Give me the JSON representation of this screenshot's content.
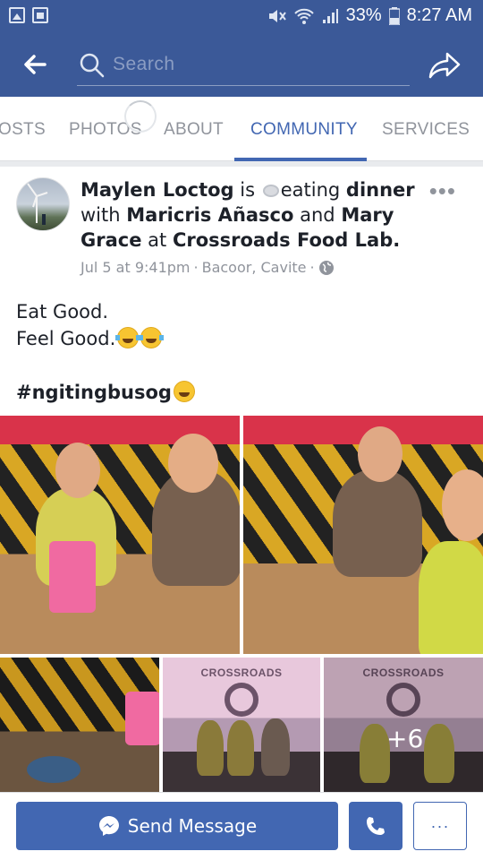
{
  "status_bar": {
    "battery": "33%",
    "time": "8:27 AM",
    "icons": [
      "gallery-icon",
      "bag-icon",
      "mute-icon",
      "wifi-icon",
      "signal-icon",
      "battery-icon"
    ]
  },
  "app_bar": {
    "search_placeholder": "Search",
    "colors": {
      "bar": "#3b5998",
      "accent": "#4267b2"
    }
  },
  "tabs": [
    {
      "label": "OSTS",
      "active": false
    },
    {
      "label": "PHOTOS",
      "active": false
    },
    {
      "label": "ABOUT",
      "active": false
    },
    {
      "label": "COMMUNITY",
      "active": true
    },
    {
      "label": "SERVICES",
      "active": false
    }
  ],
  "post": {
    "author": "Maylen Loctog",
    "is": "is",
    "activity": "eating",
    "activity_object": "dinner",
    "with": "with",
    "tagged_1": "Maricris Añasco",
    "and": "and",
    "tagged_2": "Mary Grace",
    "at": "at",
    "place": "Crossroads Food Lab.",
    "date": "Jul 5 at 9:41pm",
    "separator": "·",
    "location": "Bacoor, Cavite",
    "privacy": "public",
    "body_line_1": "Eat Good.",
    "body_line_2": "Feel Good.",
    "hashtag": "#ngitingbusog",
    "photo_logo_text": "CROSSROADS",
    "more_photos": "+6"
  },
  "bottom_bar": {
    "send_message": "Send Message",
    "more": "···"
  }
}
